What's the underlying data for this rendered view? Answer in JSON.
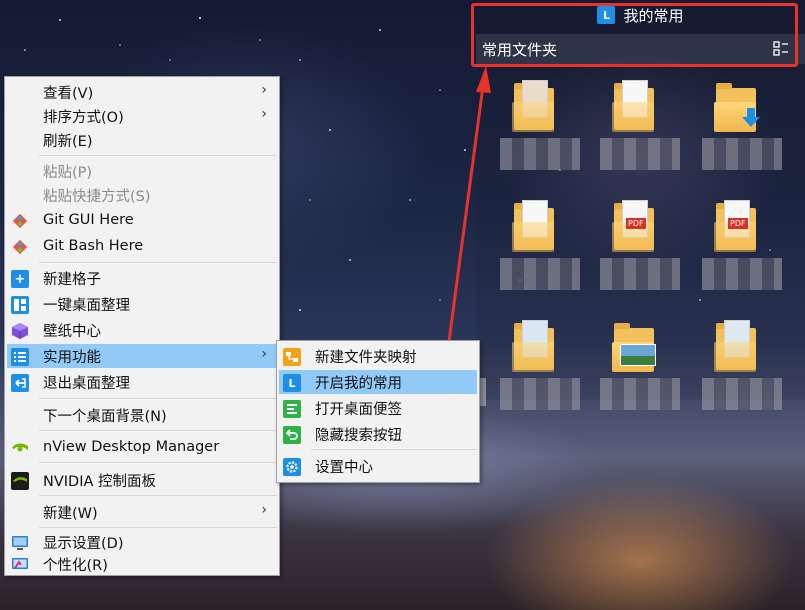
{
  "fence": {
    "title": "我的常用",
    "logo_letter": "L",
    "subtitle": "常用文件夹",
    "layout_icon": "layout-toggle-icon",
    "folders": [
      {
        "icon": "folder-with-documents-icon"
      },
      {
        "icon": "folder-with-documents-icon"
      },
      {
        "icon": "folder-download-icon"
      },
      {
        "icon": "folder-with-documents-icon"
      },
      {
        "icon": "folder-pdf-icon",
        "tag": "PDF"
      },
      {
        "icon": "folder-pdf-icon",
        "tag": "PDF"
      },
      {
        "icon": "folder-with-documents-icon"
      },
      {
        "icon": "folder-images-icon"
      },
      {
        "icon": "folder-with-documents-icon"
      }
    ]
  },
  "context_menu": {
    "items": [
      {
        "label": "查看(V)",
        "has_submenu": true
      },
      {
        "label": "排序方式(O)",
        "has_submenu": true
      },
      {
        "label": "刷新(E)"
      },
      {
        "label": "粘贴(P)",
        "disabled": true
      },
      {
        "label": "粘贴快捷方式(S)",
        "disabled": true
      },
      {
        "label": "Git GUI Here",
        "icon": "git-icon"
      },
      {
        "label": "Git Bash Here",
        "icon": "git-icon"
      },
      {
        "label": "新建格子",
        "icon": "plus-icon"
      },
      {
        "label": "一键桌面整理",
        "icon": "grid-layout-icon"
      },
      {
        "label": "壁纸中心",
        "icon": "cube-icon"
      },
      {
        "label": "实用功能",
        "icon": "list-icon",
        "has_submenu": true,
        "highlighted": true
      },
      {
        "label": "退出桌面整理",
        "icon": "exit-icon"
      },
      {
        "label": "下一个桌面背景(N)"
      },
      {
        "label": "nView Desktop Manager",
        "icon": "nvidia-icon"
      },
      {
        "label": "NVIDIA 控制面板",
        "icon": "nvidia-icon"
      },
      {
        "label": "新建(W)",
        "has_submenu": true
      },
      {
        "label": "显示设置(D)",
        "icon": "display-icon"
      },
      {
        "label": "个性化(R)",
        "icon": "personalize-icon"
      }
    ]
  },
  "submenu": {
    "items": [
      {
        "label": "新建文件夹映射",
        "icon": "folder-map-icon"
      },
      {
        "label": "开启我的常用",
        "icon": "fence-l-icon",
        "highlighted": true
      },
      {
        "label": "打开桌面便签",
        "icon": "sticky-note-icon"
      },
      {
        "label": "隐藏搜索按钮",
        "icon": "undo-icon"
      },
      {
        "label": "设置中心",
        "icon": "settings-gear-icon"
      }
    ]
  },
  "colors": {
    "accent_blue": "#1e8fe6",
    "hover_blue": "#91c9f7",
    "annotation_red": "#e8322a",
    "nvidia_green": "#76b900"
  }
}
